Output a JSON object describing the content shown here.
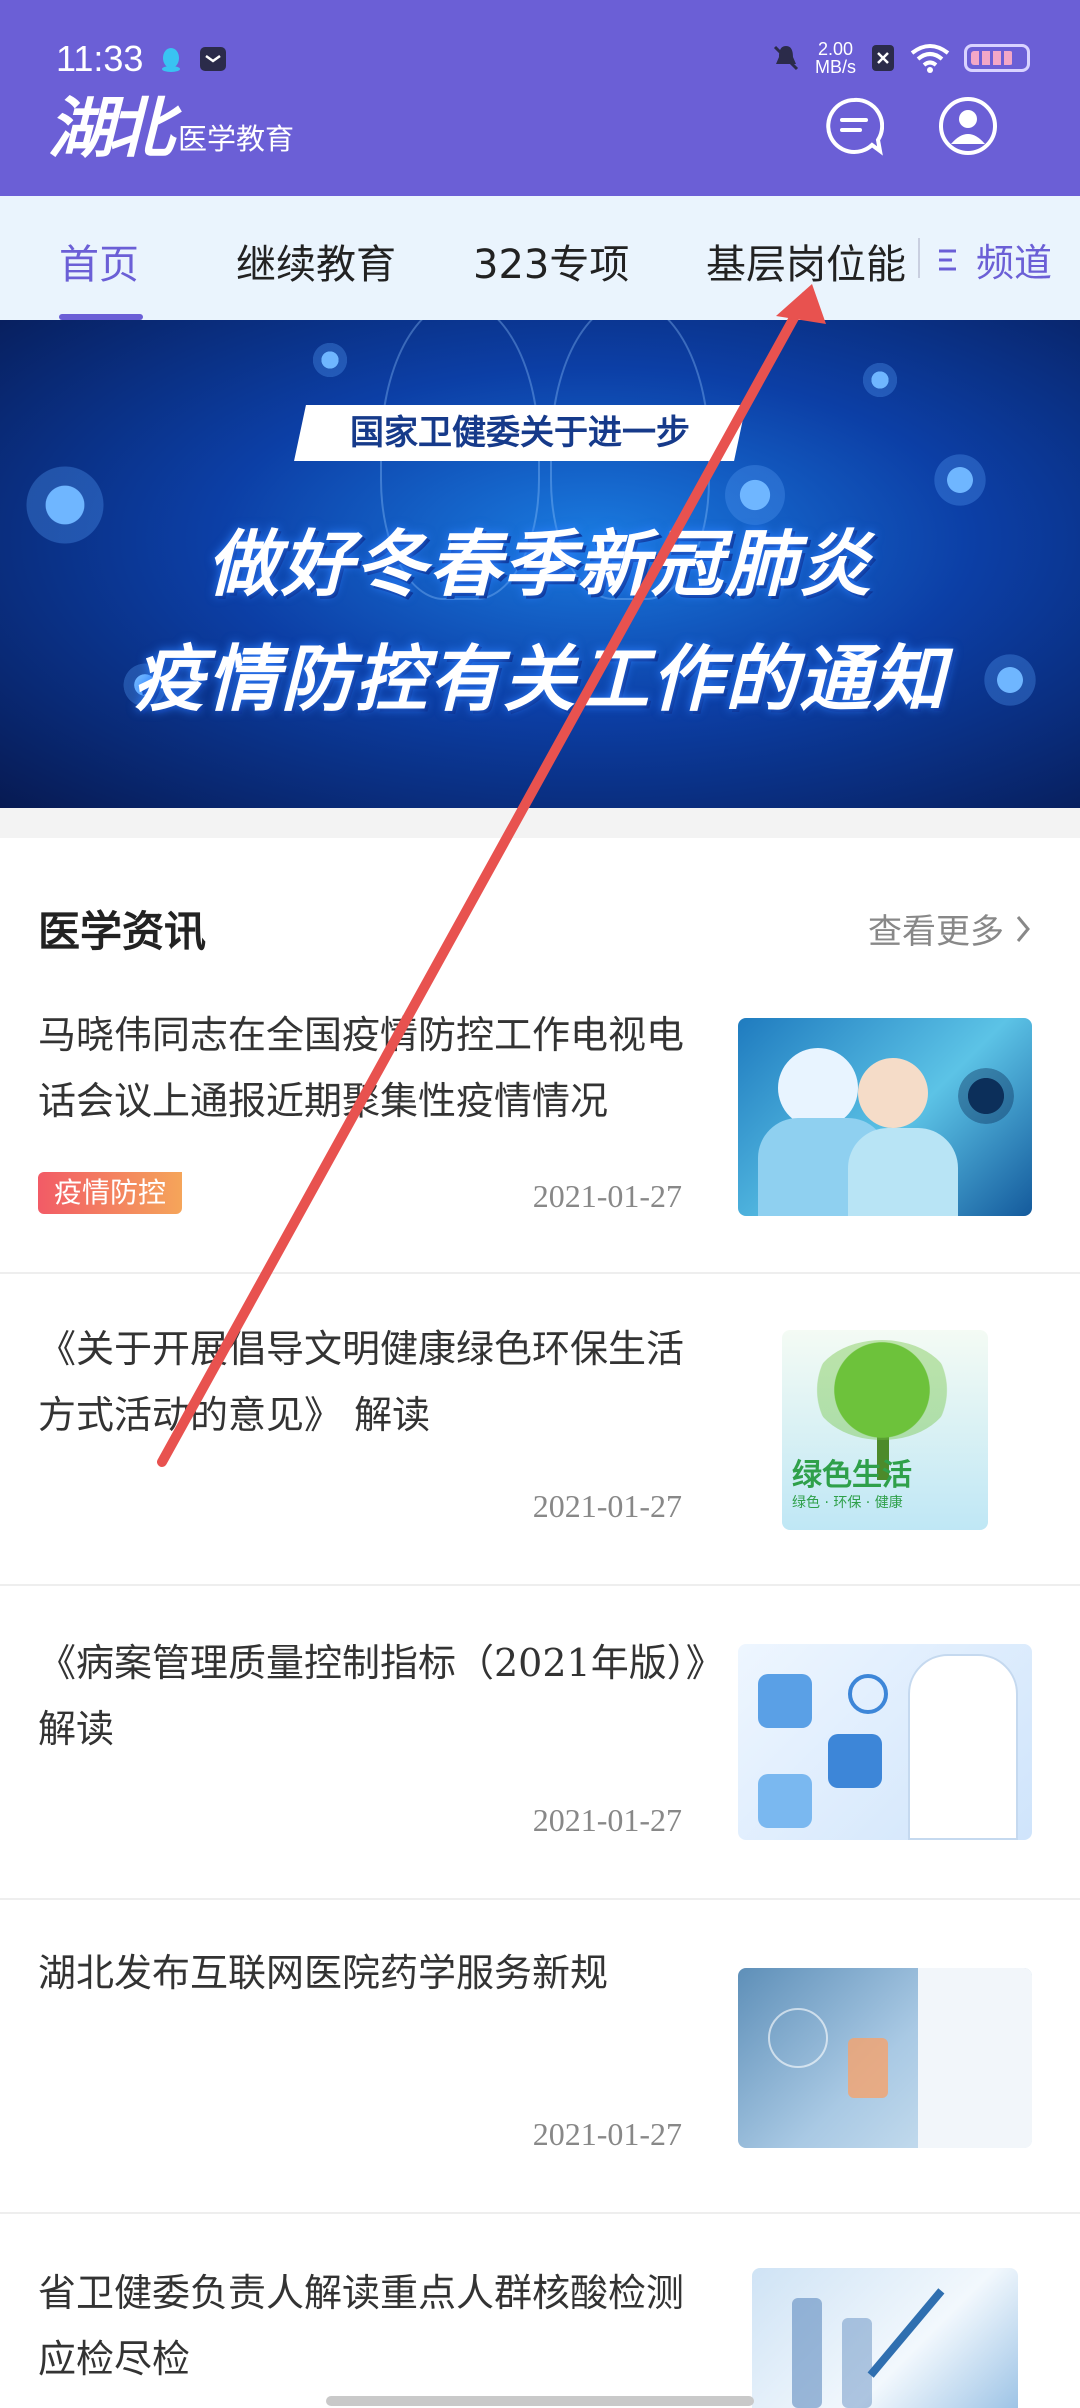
{
  "status_bar": {
    "time": "11:33",
    "net_speed_value": "2.00",
    "net_speed_unit": "MB/s",
    "icons": [
      "qq-icon",
      "message-icon",
      "mute-icon",
      "sim-icon",
      "wifi-icon",
      "battery-icon"
    ]
  },
  "header": {
    "logo_main": "湖北",
    "logo_sub": "医学教育",
    "icons": [
      "chat-icon",
      "user-icon"
    ]
  },
  "nav": {
    "tabs": [
      {
        "label": "首页",
        "active": true
      },
      {
        "label": "继续教育",
        "active": false
      },
      {
        "label": "323专项",
        "active": false
      },
      {
        "label": "基层岗位能",
        "active": false
      }
    ],
    "channel_label": "频道"
  },
  "banner": {
    "strip": "国家卫健委关于进一步",
    "line1": "做好冬春季新冠肺炎",
    "line2": "疫情防控有关工作的通知"
  },
  "section": {
    "title": "医学资讯",
    "more": "查看更多"
  },
  "news": [
    {
      "title": "马晓伟同志在全国疫情防控工作电视电话会议上通报近期聚集性疫情情况",
      "tag": "疫情防控",
      "date": "2021-01-27",
      "thumb": "doctors-virus-image"
    },
    {
      "title": "《关于开展倡导文明健康绿色环保生活方式活动的意见》 解读",
      "tag": "",
      "date": "2021-01-27",
      "thumb": "green-life-image",
      "thumb_title": "绿色生活",
      "thumb_sub": "绿色 · 环保 · 健康"
    },
    {
      "title": "《病案管理质量控制指标（2021年版）》解读",
      "tag": "",
      "date": "2021-01-27",
      "thumb": "doctor-icons-image"
    },
    {
      "title": "湖北发布互联网医院药学服务新规",
      "tag": "",
      "date": "2021-01-27",
      "thumb": "pharmacy-image"
    },
    {
      "title": "省卫健委负责人解读重点人群核酸检测应检尽检",
      "tag": "",
      "date": "",
      "thumb": "lab-test-image"
    }
  ],
  "colors": {
    "brand": "#6b5fd6",
    "nav_bg": "#eaf4fd",
    "annotation_arrow": "#e8524f"
  }
}
